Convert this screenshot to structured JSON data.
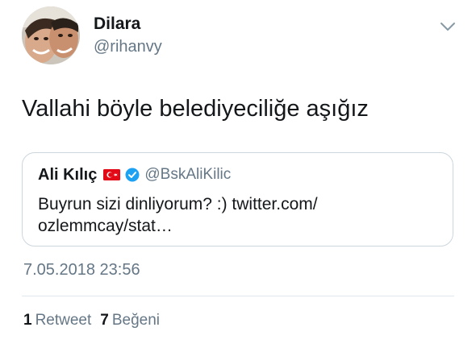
{
  "author": {
    "name": "Dilara",
    "handle": "@rihanvy",
    "avatar_icon": "profile-photo-avatar"
  },
  "menu": {
    "icon": "chevron-down-icon"
  },
  "tweet": {
    "text": "Vallahi böyle belediyeciliğe aşığız"
  },
  "quoted_tweet": {
    "name": "Ali Kılıç",
    "flag_icon": "turkey-flag-icon",
    "verified_icon": "verified-badge-icon",
    "handle": "@BskAliKilic",
    "text_line1": "Buyrun sizi dinliyorum? :) twitter.com/",
    "text_line2": "ozlemmcay/stat…"
  },
  "timestamp": "7.05.2018 23:56",
  "stats": {
    "retweets_count": "1",
    "retweets_label": "Retweet",
    "likes_count": "7",
    "likes_label": "Beğeni"
  },
  "colors": {
    "text": "#14171a",
    "secondary": "#657786",
    "border": "#ccd6dd",
    "verified": "#1da1f2",
    "flag_red": "#e30a17"
  }
}
